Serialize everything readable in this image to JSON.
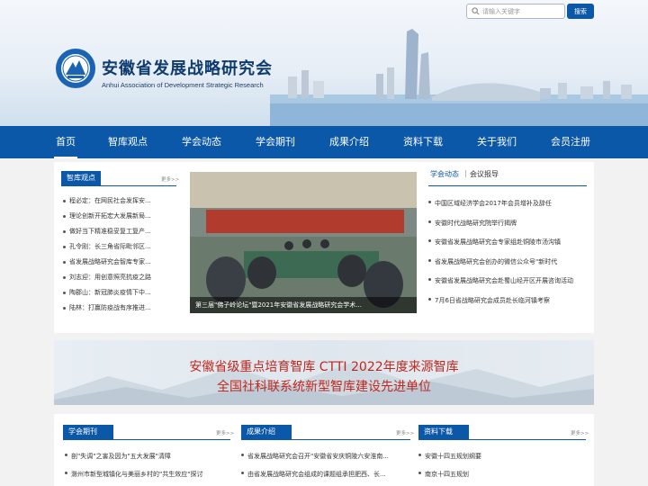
{
  "search": {
    "placeholder": "请输入关键字",
    "button": "搜索"
  },
  "site": {
    "title": "安徽省发展战略研究会",
    "subtitle": "Anhui Association of Development Strategic Research"
  },
  "nav": {
    "items": [
      {
        "label": "首页"
      },
      {
        "label": "智库观点"
      },
      {
        "label": "学会动态"
      },
      {
        "label": "学会期刊"
      },
      {
        "label": "成果介绍"
      },
      {
        "label": "资料下载"
      },
      {
        "label": "关于我们"
      },
      {
        "label": "会员注册"
      }
    ]
  },
  "think_tank": {
    "title": "智库观点",
    "more": "更多>>",
    "items": [
      "程必定：在网民社会发挥安...",
      "理论创新开拓宏大发展新局...",
      "做好当下精准稳妥复工复产...",
      "孔令刚：长三角省际毗邻区...",
      "省发展战略研究会智库专家...",
      "刘志迎：用创意照亮抗疫之路",
      "陶郡山：新冠肺炎疫情下中...",
      "陆林：打赢防疫战有序推进..."
    ]
  },
  "photo": {
    "caption": "第三届\"佛子岭论坛\"暨2021年安徽省发展战略研究会学术..."
  },
  "news": {
    "tab_active": "学会动态",
    "tab_other": "会议报导",
    "separator": "|",
    "items": [
      "中国区域经济学会2017年会员增补及辞任",
      "安徽时代战略研究院举行揭牌",
      "安徽省发展战略研究会专家组赴铜陵市汤沟镇",
      "省发展战略研究会创办的微信公众号\"新时代",
      "安徽省发展战略研究会赴蜀山经开区开展咨询活动",
      "7月6日省战略研究会成员赴长临河镇考察"
    ]
  },
  "banner": {
    "line1": "安徽省级重点培育智库    CTTI 2022年度来源智库",
    "line2": "全国社科联系统新型智库建设先进单位"
  },
  "journal": {
    "title": "学会期刊",
    "more": "更多>>",
    "items": [
      "剖\"失调\"之害及因为\"五大发展\"清障",
      "滁州市新型城镇化与美丽乡村的\"共生效应\"探讨"
    ]
  },
  "results": {
    "title": "成果介绍",
    "more": "更多>>",
    "items": [
      "省发展战略研究会召开\"安徽省安庆铜陵六安淮南...",
      "由省发展战略研究会组成的课题组承担肥西、长..."
    ]
  },
  "downloads": {
    "title": "资料下载",
    "more": "更多>>",
    "items": [
      "安徽十四五规划纲要",
      "南京十四五规划"
    ]
  },
  "colors": {
    "brand_blue": "#0b57a8",
    "banner_red": "#c0281e"
  }
}
